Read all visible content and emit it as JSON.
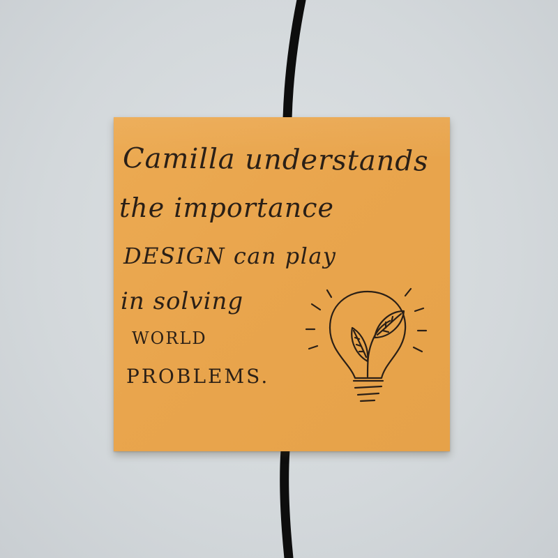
{
  "note": {
    "lines": [
      "Camilla understands",
      "the importance",
      "DESIGN can play",
      "in solving",
      "WORLD",
      "PROBLEMS."
    ],
    "paper_color": "#e9a54d",
    "ink_color": "#2a1f16"
  },
  "background": {
    "wall_color": "#d3d8db",
    "line_color": "#0d0d0d"
  },
  "drawing": {
    "icon": "lightbulb-with-leaves-icon"
  }
}
